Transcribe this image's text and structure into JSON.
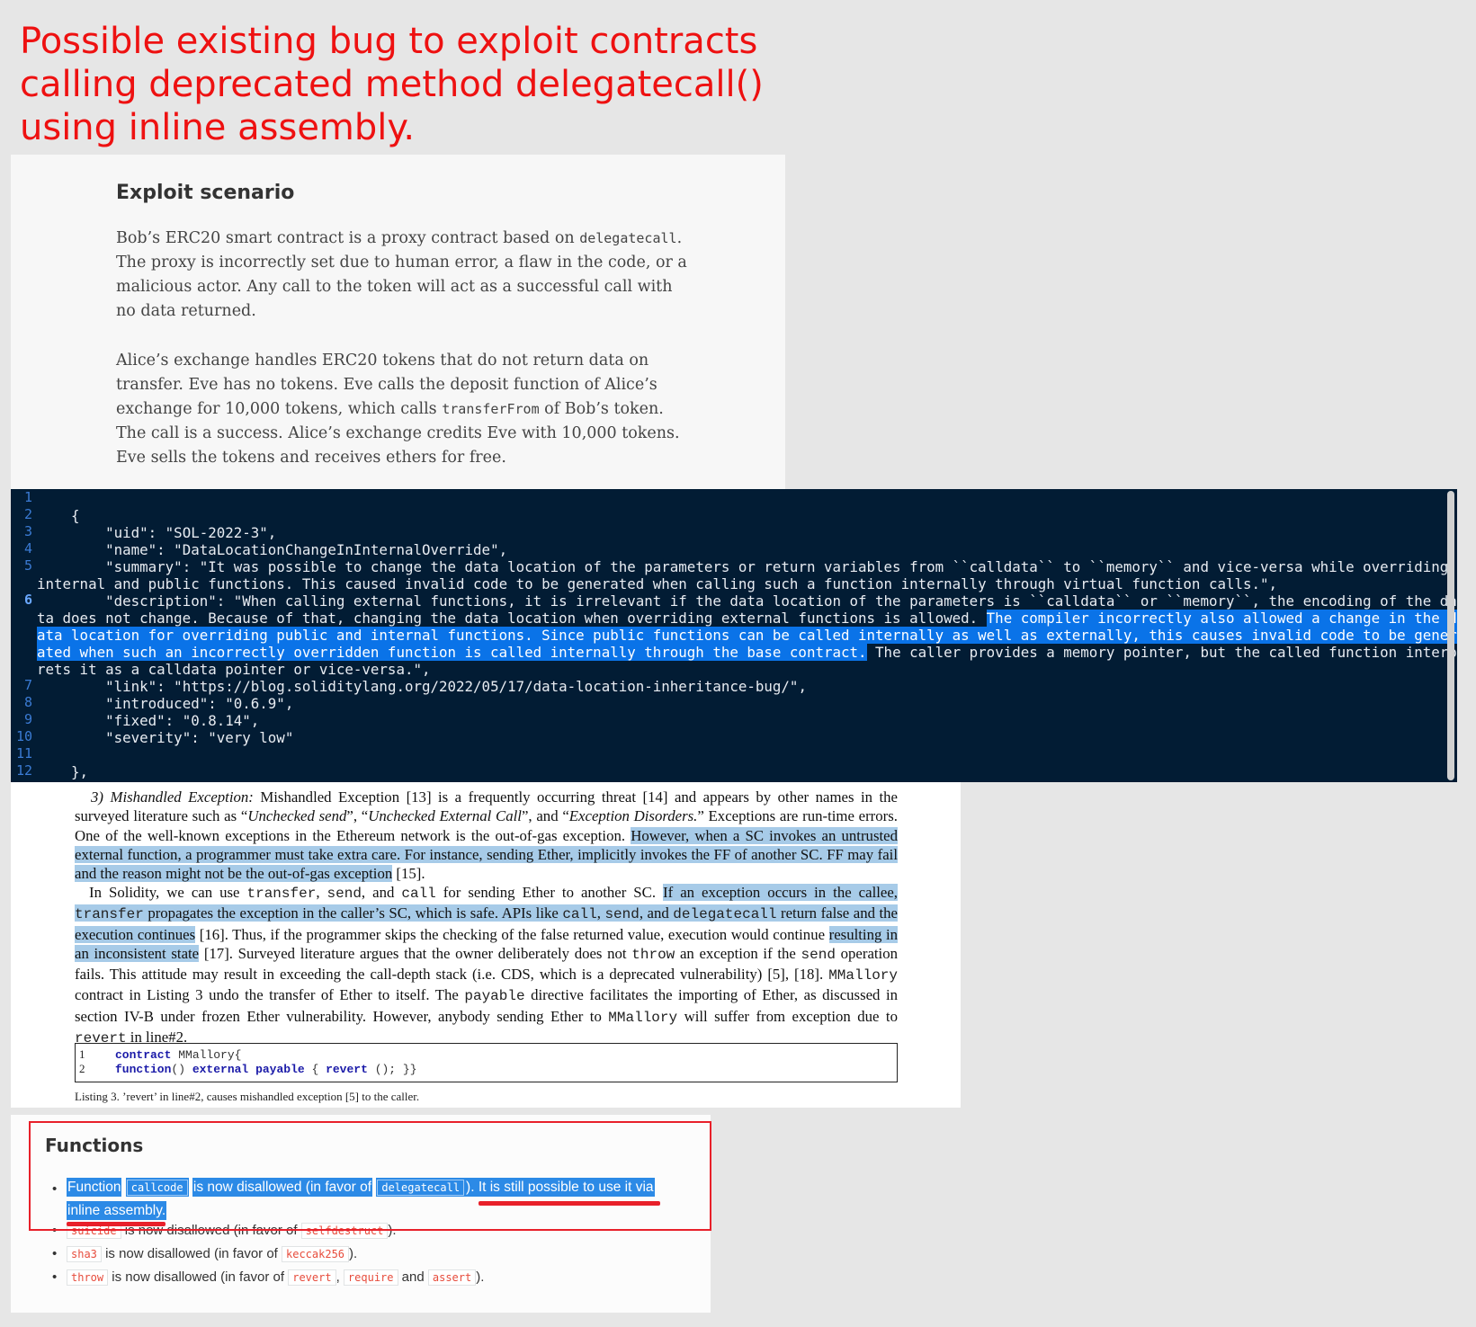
{
  "headline": "Possible existing bug to exploit contracts calling deprecated method delegatecall() using inline assembly.",
  "exploit": {
    "title": "Exploit scenario",
    "p1_a": "Bob’s ERC20 smart contract is a proxy contract based on ",
    "p1_code": "delegatecall",
    "p1_b": ". The proxy is incorrectly set due to human error, a flaw in the code, or a malicious actor. Any call to the token will act as a successful call with no data returned.",
    "p2_a": "Alice’s exchange handles ERC20 tokens that do not return data on transfer. Eve has no tokens. Eve calls the deposit function of Alice’s exchange for 10,000 tokens, which calls ",
    "p2_code": "transferFrom",
    "p2_b": " of Bob’s token. The call is a success. Alice’s exchange credits Eve with 10,000 tokens. Eve sells the tokens and receives ethers for free."
  },
  "code": {
    "line_numbers": [
      "1",
      "2",
      "3",
      "4",
      "5",
      "6",
      "7",
      "8",
      "9",
      "10",
      "11",
      "12"
    ],
    "active_line": "6",
    "l2": "    {",
    "l3": "        \"uid\": \"SOL-2022-3\",",
    "l4": "        \"name\": \"DataLocationChangeInInternalOverride\",",
    "l5": "        \"summary\": \"It was possible to change the data location of the parameters or return variables from ``calldata`` to ``memory`` and vice-versa while overriding internal and public functions. This caused invalid code to be generated when calling such a function internally through virtual function calls.\",",
    "l6_a": "        \"description\": \"When calling external functions, it is irrelevant if the data location of the parameters is ``calldata`` or ``memory``, the encoding of the data does not change. Because of that, changing the data location when overriding external functions is allowed. ",
    "l6_sel": "The compiler incorrectly also allowed a change in the data location for overriding public and internal functions. Since public functions can be called internally as well as externally, this causes invalid code to be generated when such an incorrectly overridden function is called internally through the base contract.",
    "l6_b": " The caller provides a memory pointer, but the called function interprets it as a calldata pointer or vice-versa.\",",
    "l7": "        \"link\": \"https://blog.soliditylang.org/2022/05/17/data-location-inheritance-bug/\",",
    "l8": "        \"introduced\": \"0.6.9\",",
    "l9": "        \"fixed\": \"0.8.14\",",
    "l10": "        \"severity\": \"very low\"",
    "l12": "    },"
  },
  "paper": {
    "p1_label": "3) Mishandled Exception:",
    "p1_a": " Mishandled Exception [13] is a frequently occurring threat [14] and appears by other names in the surveyed literature such as “",
    "p1_i1": "Unchecked send",
    "p1_b": "”, “",
    "p1_i2": "Unchecked External Call",
    "p1_c": "”, and “",
    "p1_i3": "Exception Disorders.",
    "p1_d": "” Exceptions are run-time errors. One of the well-known exceptions in the Ethereum network is the out-of-gas exception. ",
    "p1_hl": "However, when a SC invokes an untrusted external function, a programmer must take extra care. For instance, sending Ether, implicitly invokes the FF of another SC. FF may fail and the reason might not be the out-of-gas exception",
    "p1_e": " [15].",
    "p2_a": "In Solidity, we can use ",
    "p2_m1": "transfer",
    "p2_b": ", ",
    "p2_m2": "send",
    "p2_c": ", and ",
    "p2_m3": "call",
    "p2_d": " for sending Ether to another SC. ",
    "p2_hl1": "If an exception occurs in the callee, ",
    "p2_hm1": "transfer",
    "p2_hl2": " propagates the exception in the caller’s SC, which is safe. APIs like ",
    "p2_hm2": "call",
    "p2_hl3": ", ",
    "p2_hm3": "send",
    "p2_hl4": ", and ",
    "p2_hm4": "delegatecall",
    "p2_hl5": " return false and the execution continues",
    "p2_e": " [16]. Thus, if the programmer skips the checking of the false returned value, execution would continue ",
    "p2_hl6": "resulting in an inconsistent state",
    "p2_f": " [17]. Surveyed literature argues that the owner deliberately does not ",
    "p2_m4": "throw",
    "p2_g": " an exception if the ",
    "p2_m5": "send",
    "p2_h": " operation fails. This attitude may result in exceeding the call-depth stack (i.e. CDS, which is a deprecated vulnerability) [5], [18]. ",
    "p2_m6": "MMallory",
    "p2_i": " contract in Listing 3 undo the transfer of Ether to itself. The ",
    "p2_m7": "payable",
    "p2_j": " directive facilitates the importing of Ether, as discussed in section IV-B under frozen Ether vulnerability. However, anybody sending Ether to ",
    "p2_m8": "MMallory",
    "p2_k": " will suffer from exception due to ",
    "p2_m9": "revert",
    "p2_l": " in line#2.",
    "listing": {
      "n1": "1",
      "n2": "2",
      "l1_kw": "contract",
      "l1_rest": " MMallory{",
      "l2_kw1": "function",
      "l2_a": "() ",
      "l2_kw2": "external",
      "l2_b": " ",
      "l2_kw3": "payable",
      "l2_c": " { ",
      "l2_kw4": "revert",
      "l2_d": " (); }}"
    },
    "caption": "Listing 3.  ’revert’ in line#2, causes mishandled exception [5] to the caller."
  },
  "functions": {
    "title": "Functions",
    "i1_a": "Function",
    "i1_tag1": "callcode",
    "i1_b": "is now disallowed (in favor of",
    "i1_tag2": "delegatecall",
    "i1_c": "). It is still possible to use it via",
    "i1_d": "inline assembly.",
    "i2_tag1": "suicide",
    "i2_a": " is now disallowed (in favor of ",
    "i2_tag2": "selfdestruct",
    "i2_b": ").",
    "i3_tag1": "sha3",
    "i3_a": " is now disallowed (in favor of ",
    "i3_tag2": "keccak256",
    "i3_b": ").",
    "i4_tag1": "throw",
    "i4_a": " is now disallowed (in favor of ",
    "i4_tag2": "revert",
    "i4_b": ", ",
    "i4_tag3": "require",
    "i4_c": " and ",
    "i4_tag4": "assert",
    "i4_d": ")."
  },
  "colors": {
    "headline": "#ee1111",
    "code_bg": "#021c34",
    "selection": "#0a73e8",
    "paper_highlight": "#a7cbe8",
    "annotation_red": "#e8202a"
  }
}
